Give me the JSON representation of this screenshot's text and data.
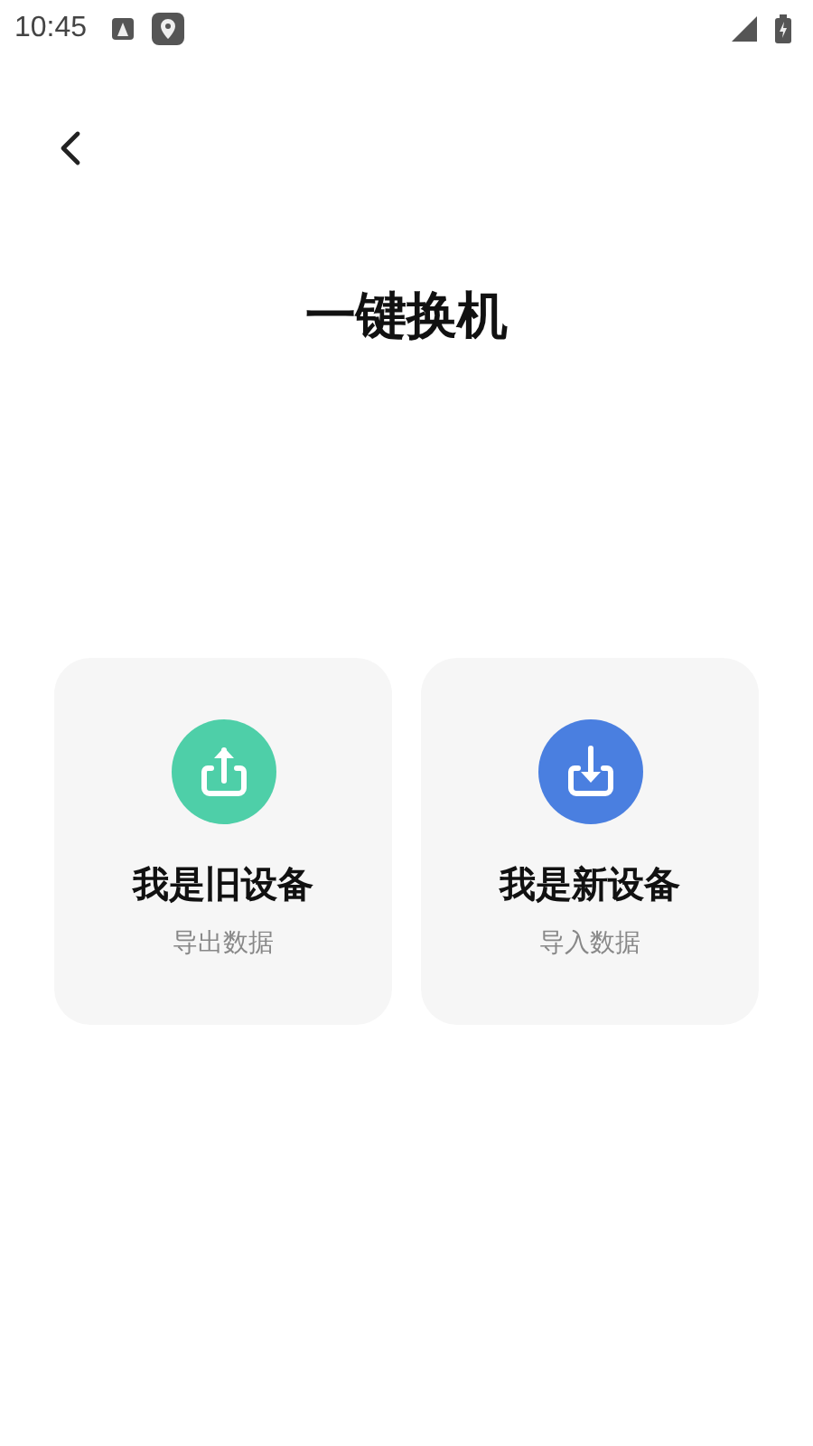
{
  "status_bar": {
    "time": "10:45"
  },
  "title": "一键换机",
  "options": [
    {
      "kind": "export",
      "title": "我是旧设备",
      "subtitle": "导出数据",
      "color": "#4ecfa8"
    },
    {
      "kind": "import",
      "title": "我是新设备",
      "subtitle": "导入数据",
      "color": "#4a7fe0"
    }
  ]
}
